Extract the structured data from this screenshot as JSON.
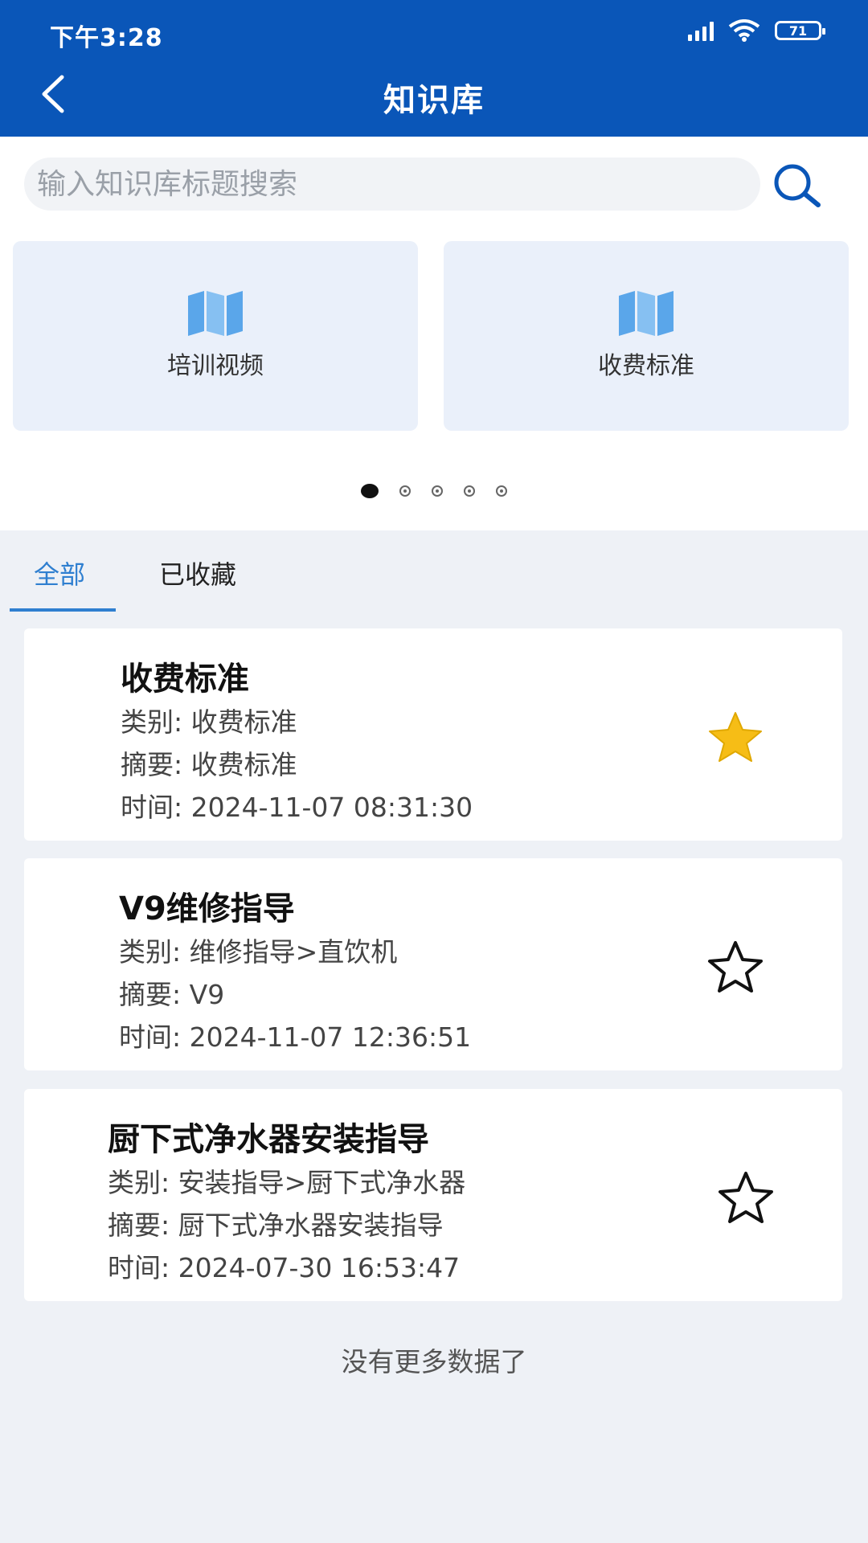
{
  "status_bar": {
    "time": "下午3:28",
    "battery": "71"
  },
  "header": {
    "title": "知识库"
  },
  "search": {
    "placeholder": "输入知识库标题搜索"
  },
  "tiles": [
    {
      "label": "培训视频",
      "icon": "map-icon"
    },
    {
      "label": "收费标准",
      "icon": "map-icon"
    }
  ],
  "pager": {
    "pages": 5,
    "active": 1
  },
  "tabs": [
    {
      "label": "全部",
      "active": true
    },
    {
      "label": "已收藏",
      "active": false
    }
  ],
  "items": [
    {
      "title": "收费标准",
      "category_label": "类别:",
      "category": "收费标准",
      "summary_label": "摘要:",
      "summary": "收费标准",
      "time_label": "时间:",
      "time": "2024-11-07 08:31:30",
      "favorited": true
    },
    {
      "title": "V9维修指导",
      "category_label": "类别:",
      "category": "维修指导>直饮机",
      "summary_label": "摘要:",
      "summary": "V9",
      "time_label": "时间:",
      "time": "2024-11-07 12:36:51",
      "favorited": false
    },
    {
      "title": "厨下式净水器安装指导",
      "category_label": "类别:",
      "category": "安装指导>厨下式净水器",
      "summary_label": "摘要:",
      "summary": "厨下式净水器安装指导",
      "time_label": "时间:",
      "time": "2024-07-30 16:53:47",
      "favorited": false
    }
  ],
  "footer": {
    "no_more": "没有更多数据了"
  },
  "colors": {
    "header": "#0a56b8",
    "accent": "#2f7fd0",
    "star_filled": "#f6bd16"
  }
}
